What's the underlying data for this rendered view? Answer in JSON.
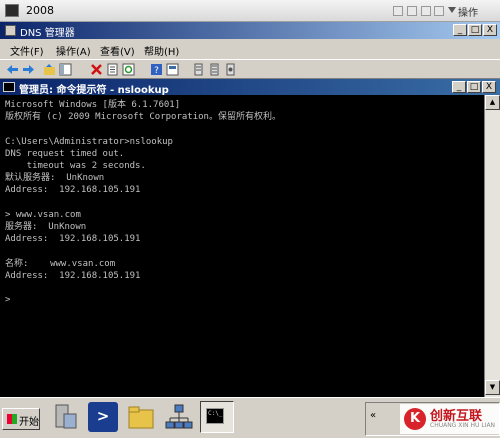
{
  "vm": {
    "title": "2008",
    "action_label": "操作"
  },
  "dns": {
    "title": "DNS 管理器",
    "menu": [
      "文件(F)",
      "操作(A)",
      "查看(V)",
      "帮助(H)"
    ],
    "caption": {
      "minimize": "_",
      "restore": "□",
      "close": "X"
    }
  },
  "cmd": {
    "title": "管理员: 命令提示符 - nslookup",
    "caption": {
      "minimize": "_",
      "maximize": "□",
      "close": "X"
    },
    "output": "Microsoft Windows [版本 6.1.7601]\n版权所有 (c) 2009 Microsoft Corporation。保留所有权利。\n\nC:\\Users\\Administrator>nslookup\nDNS request timed out.\n    timeout was 2 seconds.\n默认服务器:  UnKnown\nAddress:  192.168.105.191\n\n> www.vsan.com\n服务器:  UnKnown\nAddress:  192.168.105.191\n\n名称:    www.vsan.com\nAddress:  192.168.105.191\n\n>"
  },
  "taskbar": {
    "start_label": "开始",
    "powershell_glyph": ">",
    "cmd_glyph": "C:\\_",
    "tray_chevron": "«"
  },
  "watermark": {
    "logo": "K",
    "line1": "创新互联",
    "line2": "CHUANG XIN HU LIAN"
  },
  "icons": [
    "vm-app-icon",
    "dns-icon",
    "back-arrow-icon",
    "forward-arrow-icon",
    "up-folder-icon",
    "console-tree-icon",
    "delete-icon",
    "properties-icon",
    "refresh-icon",
    "help-icon",
    "server-manager-icon",
    "powershell-icon",
    "explorer-folder-icon",
    "network-icon",
    "cmd-icon"
  ]
}
